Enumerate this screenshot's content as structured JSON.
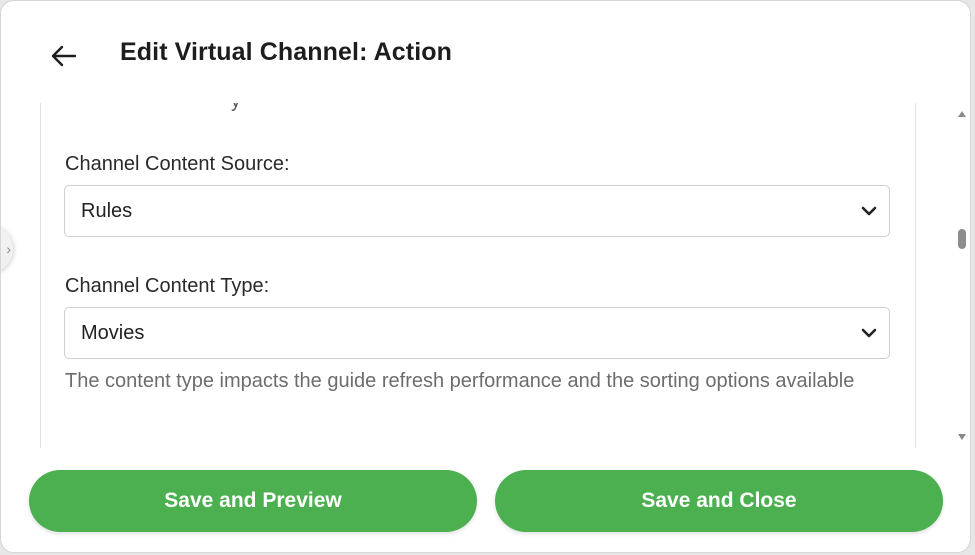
{
  "header": {
    "back_icon": "arrow-left-icon",
    "title": "Edit Virtual Channel: Action"
  },
  "form": {
    "cut_text": "y",
    "content_source": {
      "label": "Channel Content Source:",
      "value": "Rules"
    },
    "content_type": {
      "label": "Channel Content Type:",
      "value": "Movies",
      "help": "The content type impacts the guide refresh performance and the sorting options available"
    }
  },
  "footer": {
    "preview_label": "Save and Preview",
    "close_label": "Save and Close"
  },
  "colors": {
    "accent": "#4caf50",
    "text": "#2a2a2a",
    "help_text": "#6d6d6d"
  }
}
